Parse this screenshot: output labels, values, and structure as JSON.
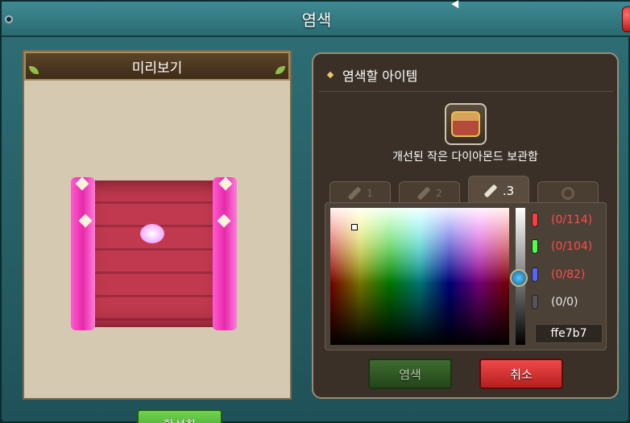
{
  "window": {
    "title": "염색",
    "accent": "#2f6f76"
  },
  "preview": {
    "title": "미리보기",
    "activate_label": "활성화",
    "chest_color": "#c0394e",
    "band_color": "#e62aa8"
  },
  "dye": {
    "title": "염색할 아이템",
    "item_icon": "diamond-storage-chest-icon",
    "item_name": "개선된 작은 다이아몬드 보관함",
    "tabs": [
      {
        "label": "1",
        "icon": "brush-icon"
      },
      {
        "label": "2",
        "icon": "brush-icon"
      },
      {
        "label": ".3",
        "icon": "brush-icon"
      },
      {
        "label": "",
        "icon": "history-icon"
      }
    ],
    "active_tab": 2,
    "rgb": [
      {
        "name": "red",
        "value": "(0/114)",
        "color": "#ff3b3b"
      },
      {
        "name": "green",
        "value": "(0/104)",
        "color": "#4dff4d"
      },
      {
        "name": "blue",
        "value": "(0/82)",
        "color": "#5566ff"
      },
      {
        "name": "black",
        "value": "(0/0)",
        "color": "#e8e8e8"
      }
    ],
    "hex": "ffe7b7",
    "dye_label": "염색",
    "cancel_label": "취소"
  }
}
